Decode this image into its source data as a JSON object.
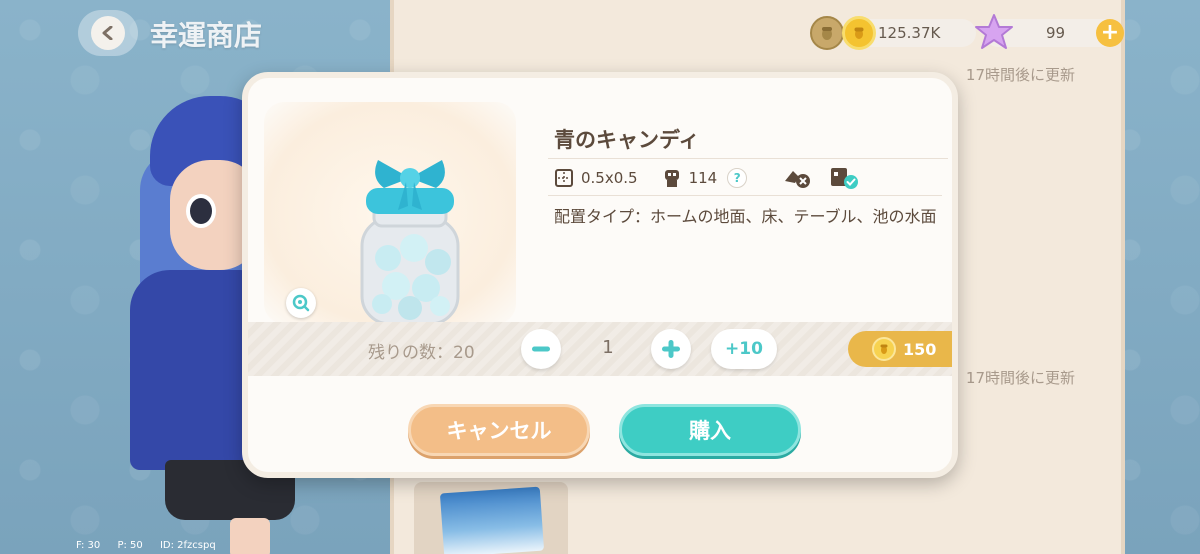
{
  "header": {
    "title": "幸運商店"
  },
  "currency": {
    "coins": "125.37K",
    "stars": "99"
  },
  "background": {
    "refresh_text_1": "17時間後に更新",
    "refresh_text_2": "17時間後に更新"
  },
  "item": {
    "name": "青のキャンディ",
    "size": "0.5x0.5",
    "count": "114",
    "help": "?",
    "placement": "配置タイプ：ホームの地面、床、テーブル、池の水面"
  },
  "purchase": {
    "remaining": "残りの数：20",
    "quantity": "1",
    "plus10_label": "+10",
    "price": "150",
    "cancel_label": "キャンセル",
    "buy_label": "購入"
  },
  "debug": {
    "f": "F: 30",
    "p": "P: 50",
    "id": "ID: 2fzcspq"
  },
  "colors": {
    "teal_accent": "#3ecdc4",
    "cancel_orange": "#f3be88",
    "coin_gold": "#f4c330",
    "text_brown": "#5c4a3c"
  },
  "icons": {
    "back": "chevron-left-icon",
    "coin": "acorn-coin-icon",
    "star": "star-icon",
    "size": "grid-size-icon",
    "count": "character-count-icon",
    "not_stackable": "no-stack-icon",
    "placeable": "placeable-check-icon",
    "zoom": "zoom-icon"
  }
}
